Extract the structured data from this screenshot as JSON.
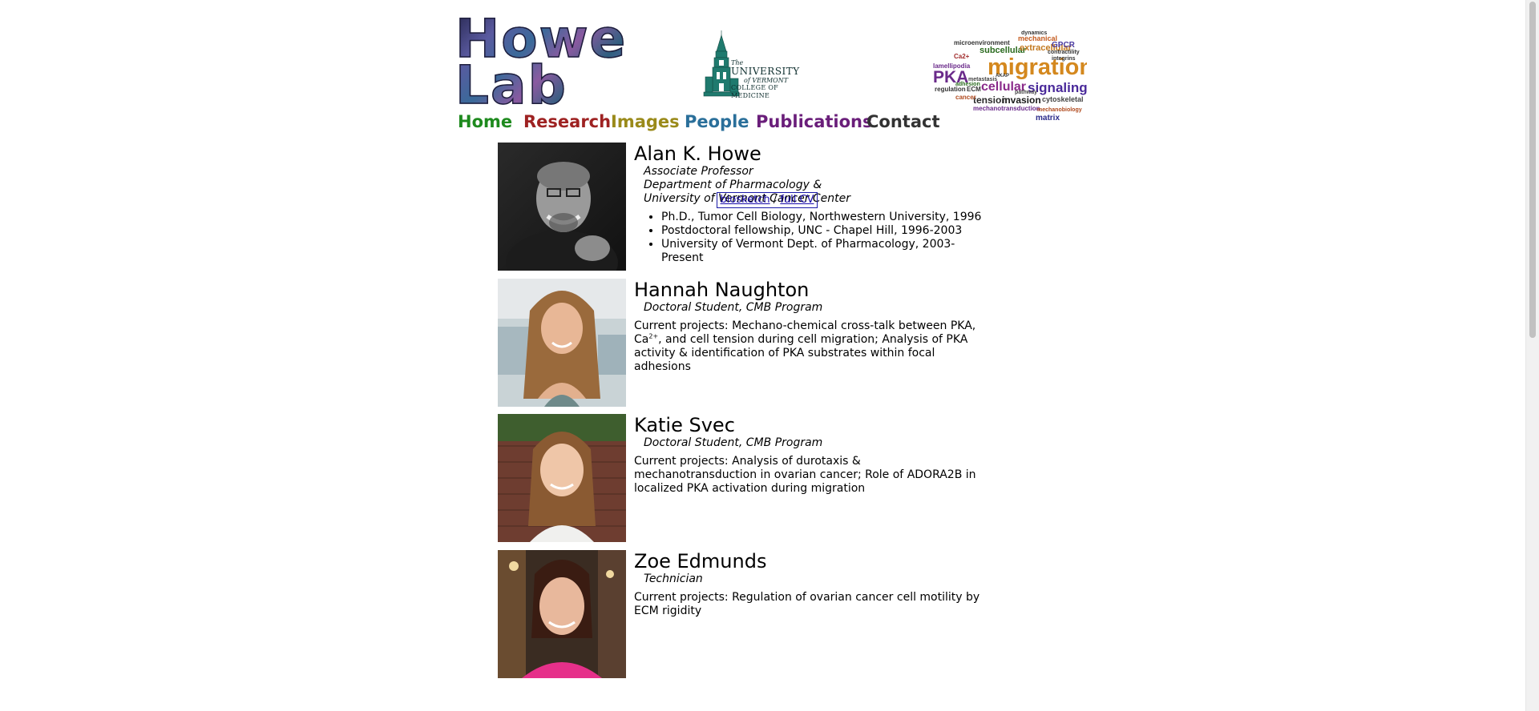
{
  "header": {
    "logo_text": "Howe Lab",
    "logo_line1": "Howe",
    "logo_line2": "Lab",
    "institution": {
      "line1": "The",
      "line2": "UNIVERSITY",
      "line3": "of VERMONT",
      "line4": "COLLEGE OF MEDICINE"
    },
    "word_cloud": [
      "migration",
      "PKA",
      "signaling",
      "cellular",
      "subcellular",
      "extracellular",
      "GPCR",
      "mechanical",
      "dynamics",
      "microenvironment",
      "invasion",
      "tension",
      "lamellipodia",
      "regulation",
      "cytoskeletal",
      "mechanotransduction",
      "matrix",
      "mechanobiology",
      "contractility",
      "integrins",
      "cancer",
      "ECM",
      "Ca2+",
      "AKAP",
      "adhesion",
      "metastasis",
      "pathway"
    ]
  },
  "nav": [
    {
      "label": "Home",
      "color": "#1e8a1e"
    },
    {
      "label": "Research",
      "color": "#9e2222"
    },
    {
      "label": "Images",
      "color": "#9a8a1a"
    },
    {
      "label": "People",
      "color": "#2a6f9a"
    },
    {
      "label": "Publications",
      "color": "#6a1e7a"
    },
    {
      "label": "Contact",
      "color": "#333333"
    }
  ],
  "people": [
    {
      "name": "Alan K. Howe",
      "title_lines": [
        "Associate Professor",
        "Department of Pharmacology &",
        "University of Vermont Cancer Center"
      ],
      "education": [
        "Ph.D., Tumor Cell Biology, Northwestern University, 1996",
        "Postdoctoral fellowship, UNC - Chapel Hill, 1996-2003",
        "University of Vermont Dept. of Pharmacology, 2003-Present"
      ],
      "links": {
        "biosketch": "biosketch",
        "separator": "/",
        "cv": "full CV"
      }
    },
    {
      "name": "Hannah Naughton",
      "title": "Doctoral Student, CMB Program",
      "projects_before": "Current projects: Mechano-chemical cross-talk between PKA, Ca",
      "projects_sup": "2+",
      "projects_after": ", and cell tension during cell migration; Analysis of PKA activity & identification of PKA substrates within focal adhesions"
    },
    {
      "name": "Katie Svec",
      "title": "Doctoral Student, CMB Program",
      "projects": "Current projects: Analysis of durotaxis & mechanotransduction in ovarian cancer; Role of ADORA2B in localized PKA activation during migration"
    },
    {
      "name": "Zoe Edmunds",
      "title": "Technician",
      "projects": "Current projects: Regulation of ovarian cancer cell motility by ECM rigidity"
    }
  ]
}
